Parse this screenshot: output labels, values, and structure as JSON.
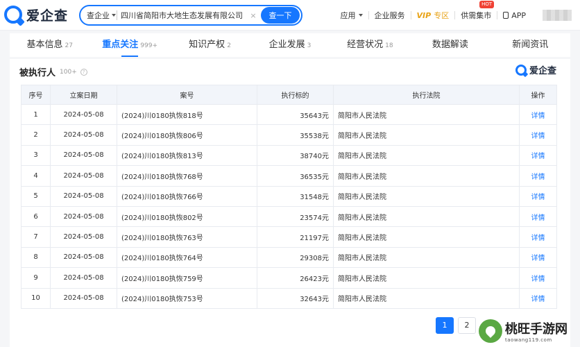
{
  "brand": {
    "name": "爱企查"
  },
  "search": {
    "type_label": "查企业",
    "value": "四川省简阳市大地生态发展有限公司",
    "clear": "×",
    "button": "查一下"
  },
  "topnav": {
    "app": "应用",
    "enterprise_service": "企业服务",
    "vip_mark": "VIP",
    "vip_label": "专区",
    "supply_market": "供需集市",
    "hot_badge": "HOT",
    "app_download": "APP"
  },
  "tabs": [
    {
      "label": "基本信息",
      "count": "27"
    },
    {
      "label": "重点关注",
      "count": "999+"
    },
    {
      "label": "知识产权",
      "count": "2"
    },
    {
      "label": "企业发展",
      "count": "3"
    },
    {
      "label": "经营状况",
      "count": "18"
    },
    {
      "label": "数据解读",
      "count": ""
    },
    {
      "label": "新闻资讯",
      "count": ""
    }
  ],
  "section": {
    "title": "被执行人",
    "count": "100+",
    "help": "?"
  },
  "table": {
    "headers": [
      "序号",
      "立案日期",
      "案号",
      "执行标的",
      "执行法院",
      "操作"
    ],
    "rows": [
      {
        "no": "1",
        "date": "2024-05-08",
        "case": "(2024)川0180执恢818号",
        "amount": "35643元",
        "court": "简阳市人民法院",
        "action": "详情"
      },
      {
        "no": "2",
        "date": "2024-05-08",
        "case": "(2024)川0180执恢806号",
        "amount": "35538元",
        "court": "简阳市人民法院",
        "action": "详情"
      },
      {
        "no": "3",
        "date": "2024-05-08",
        "case": "(2024)川0180执恢813号",
        "amount": "38740元",
        "court": "简阳市人民法院",
        "action": "详情"
      },
      {
        "no": "4",
        "date": "2024-05-08",
        "case": "(2024)川0180执恢768号",
        "amount": "36535元",
        "court": "简阳市人民法院",
        "action": "详情"
      },
      {
        "no": "5",
        "date": "2024-05-08",
        "case": "(2024)川0180执恢766号",
        "amount": "31548元",
        "court": "简阳市人民法院",
        "action": "详情"
      },
      {
        "no": "6",
        "date": "2024-05-08",
        "case": "(2024)川0180执恢802号",
        "amount": "23574元",
        "court": "简阳市人民法院",
        "action": "详情"
      },
      {
        "no": "7",
        "date": "2024-05-08",
        "case": "(2024)川0180执恢763号",
        "amount": "21197元",
        "court": "简阳市人民法院",
        "action": "详情"
      },
      {
        "no": "8",
        "date": "2024-05-08",
        "case": "(2024)川0180执恢764号",
        "amount": "29308元",
        "court": "简阳市人民法院",
        "action": "详情"
      },
      {
        "no": "9",
        "date": "2024-05-08",
        "case": "(2024)川0180执恢759号",
        "amount": "26423元",
        "court": "简阳市人民法院",
        "action": "详情"
      },
      {
        "no": "10",
        "date": "2024-05-08",
        "case": "(2024)川0180执恢753号",
        "amount": "32643元",
        "court": "简阳市人民法院",
        "action": "详情"
      }
    ]
  },
  "pagination": {
    "pages": [
      "1",
      "2"
    ],
    "current": "1"
  },
  "watermark": {
    "title": "桃旺手游网",
    "url": "taowang119.com"
  },
  "colors": {
    "accent": "#1677ff",
    "vip": "#e8a317",
    "hot": "#f04134"
  }
}
